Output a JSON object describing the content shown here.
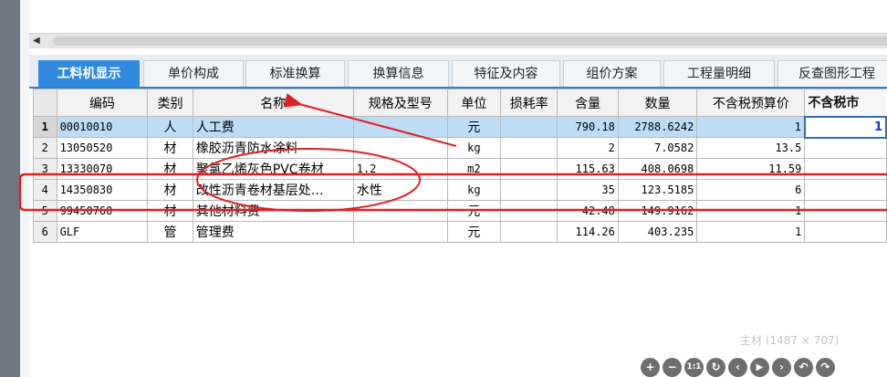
{
  "tabs": [
    {
      "label": "工料机显示"
    },
    {
      "label": "单价构成"
    },
    {
      "label": "标准换算"
    },
    {
      "label": "换算信息"
    },
    {
      "label": "特征及内容"
    },
    {
      "label": "组价方案"
    },
    {
      "label": "工程量明细"
    },
    {
      "label": "反查图形工程"
    }
  ],
  "table": {
    "headers": {
      "code": "编码",
      "category": "类别",
      "name": "名称",
      "spec": "规格及型号",
      "unit": "单位",
      "loss": "损耗率",
      "content": "含量",
      "quantity": "数量",
      "price_ex": "不含税预算价",
      "market_ex": "不含税市"
    },
    "rows": [
      {
        "num": "1",
        "code": "00010010",
        "category": "人",
        "name": "人工费",
        "spec": "",
        "unit": "元",
        "loss": "",
        "content": "790.18",
        "quantity": "2788.6242",
        "price_ex": "1",
        "market_ex": "1"
      },
      {
        "num": "2",
        "code": "13050520",
        "category": "材",
        "name": "橡胶沥青防水涂料",
        "spec": "",
        "unit": "kg",
        "loss": "",
        "content": "2",
        "quantity": "7.0582",
        "price_ex": "13.5",
        "market_ex": ""
      },
      {
        "num": "3",
        "code": "13330070",
        "category": "材",
        "name": "聚氯乙烯灰色PVC卷材",
        "spec": "1.2",
        "unit": "m2",
        "loss": "",
        "content": "115.63",
        "quantity": "408.0698",
        "price_ex": "11.59",
        "market_ex": ""
      },
      {
        "num": "4",
        "code": "14350830",
        "category": "材",
        "name": "改性沥青卷材基层处…",
        "spec": "水性",
        "unit": "kg",
        "loss": "",
        "content": "35",
        "quantity": "123.5185",
        "price_ex": "6",
        "market_ex": ""
      },
      {
        "num": "5",
        "code": "99450760",
        "category": "材",
        "name": "其他材料费",
        "spec": "",
        "unit": "元",
        "loss": "",
        "content": "42.48",
        "quantity": "149.9162",
        "price_ex": "1",
        "market_ex": ""
      },
      {
        "num": "6",
        "code": "GLF",
        "category": "管",
        "name": "管理费",
        "spec": "",
        "unit": "元",
        "loss": "",
        "content": "114.26",
        "quantity": "403.235",
        "price_ex": "1",
        "market_ex": ""
      }
    ]
  },
  "viewer": {
    "caption": "主材 (1487 × 707)",
    "buttons": [
      {
        "glyph": "+",
        "icon": "zoom-in-icon"
      },
      {
        "glyph": "−",
        "icon": "zoom-out-icon"
      },
      {
        "glyph": "1:1",
        "icon": "actual-size-icon"
      },
      {
        "glyph": "↻",
        "icon": "reset-icon"
      },
      {
        "glyph": "‹",
        "icon": "previous-icon"
      },
      {
        "glyph": "▶",
        "icon": "play-icon"
      },
      {
        "glyph": "›",
        "icon": "next-icon"
      },
      {
        "glyph": "↶",
        "icon": "rotate-left-icon"
      },
      {
        "glyph": "↷",
        "icon": "rotate-right-icon"
      }
    ]
  },
  "colors": {
    "active_tab": "#2f8ae0",
    "selected_row": "#bfdcf7",
    "annotation_red": "#e02020"
  }
}
